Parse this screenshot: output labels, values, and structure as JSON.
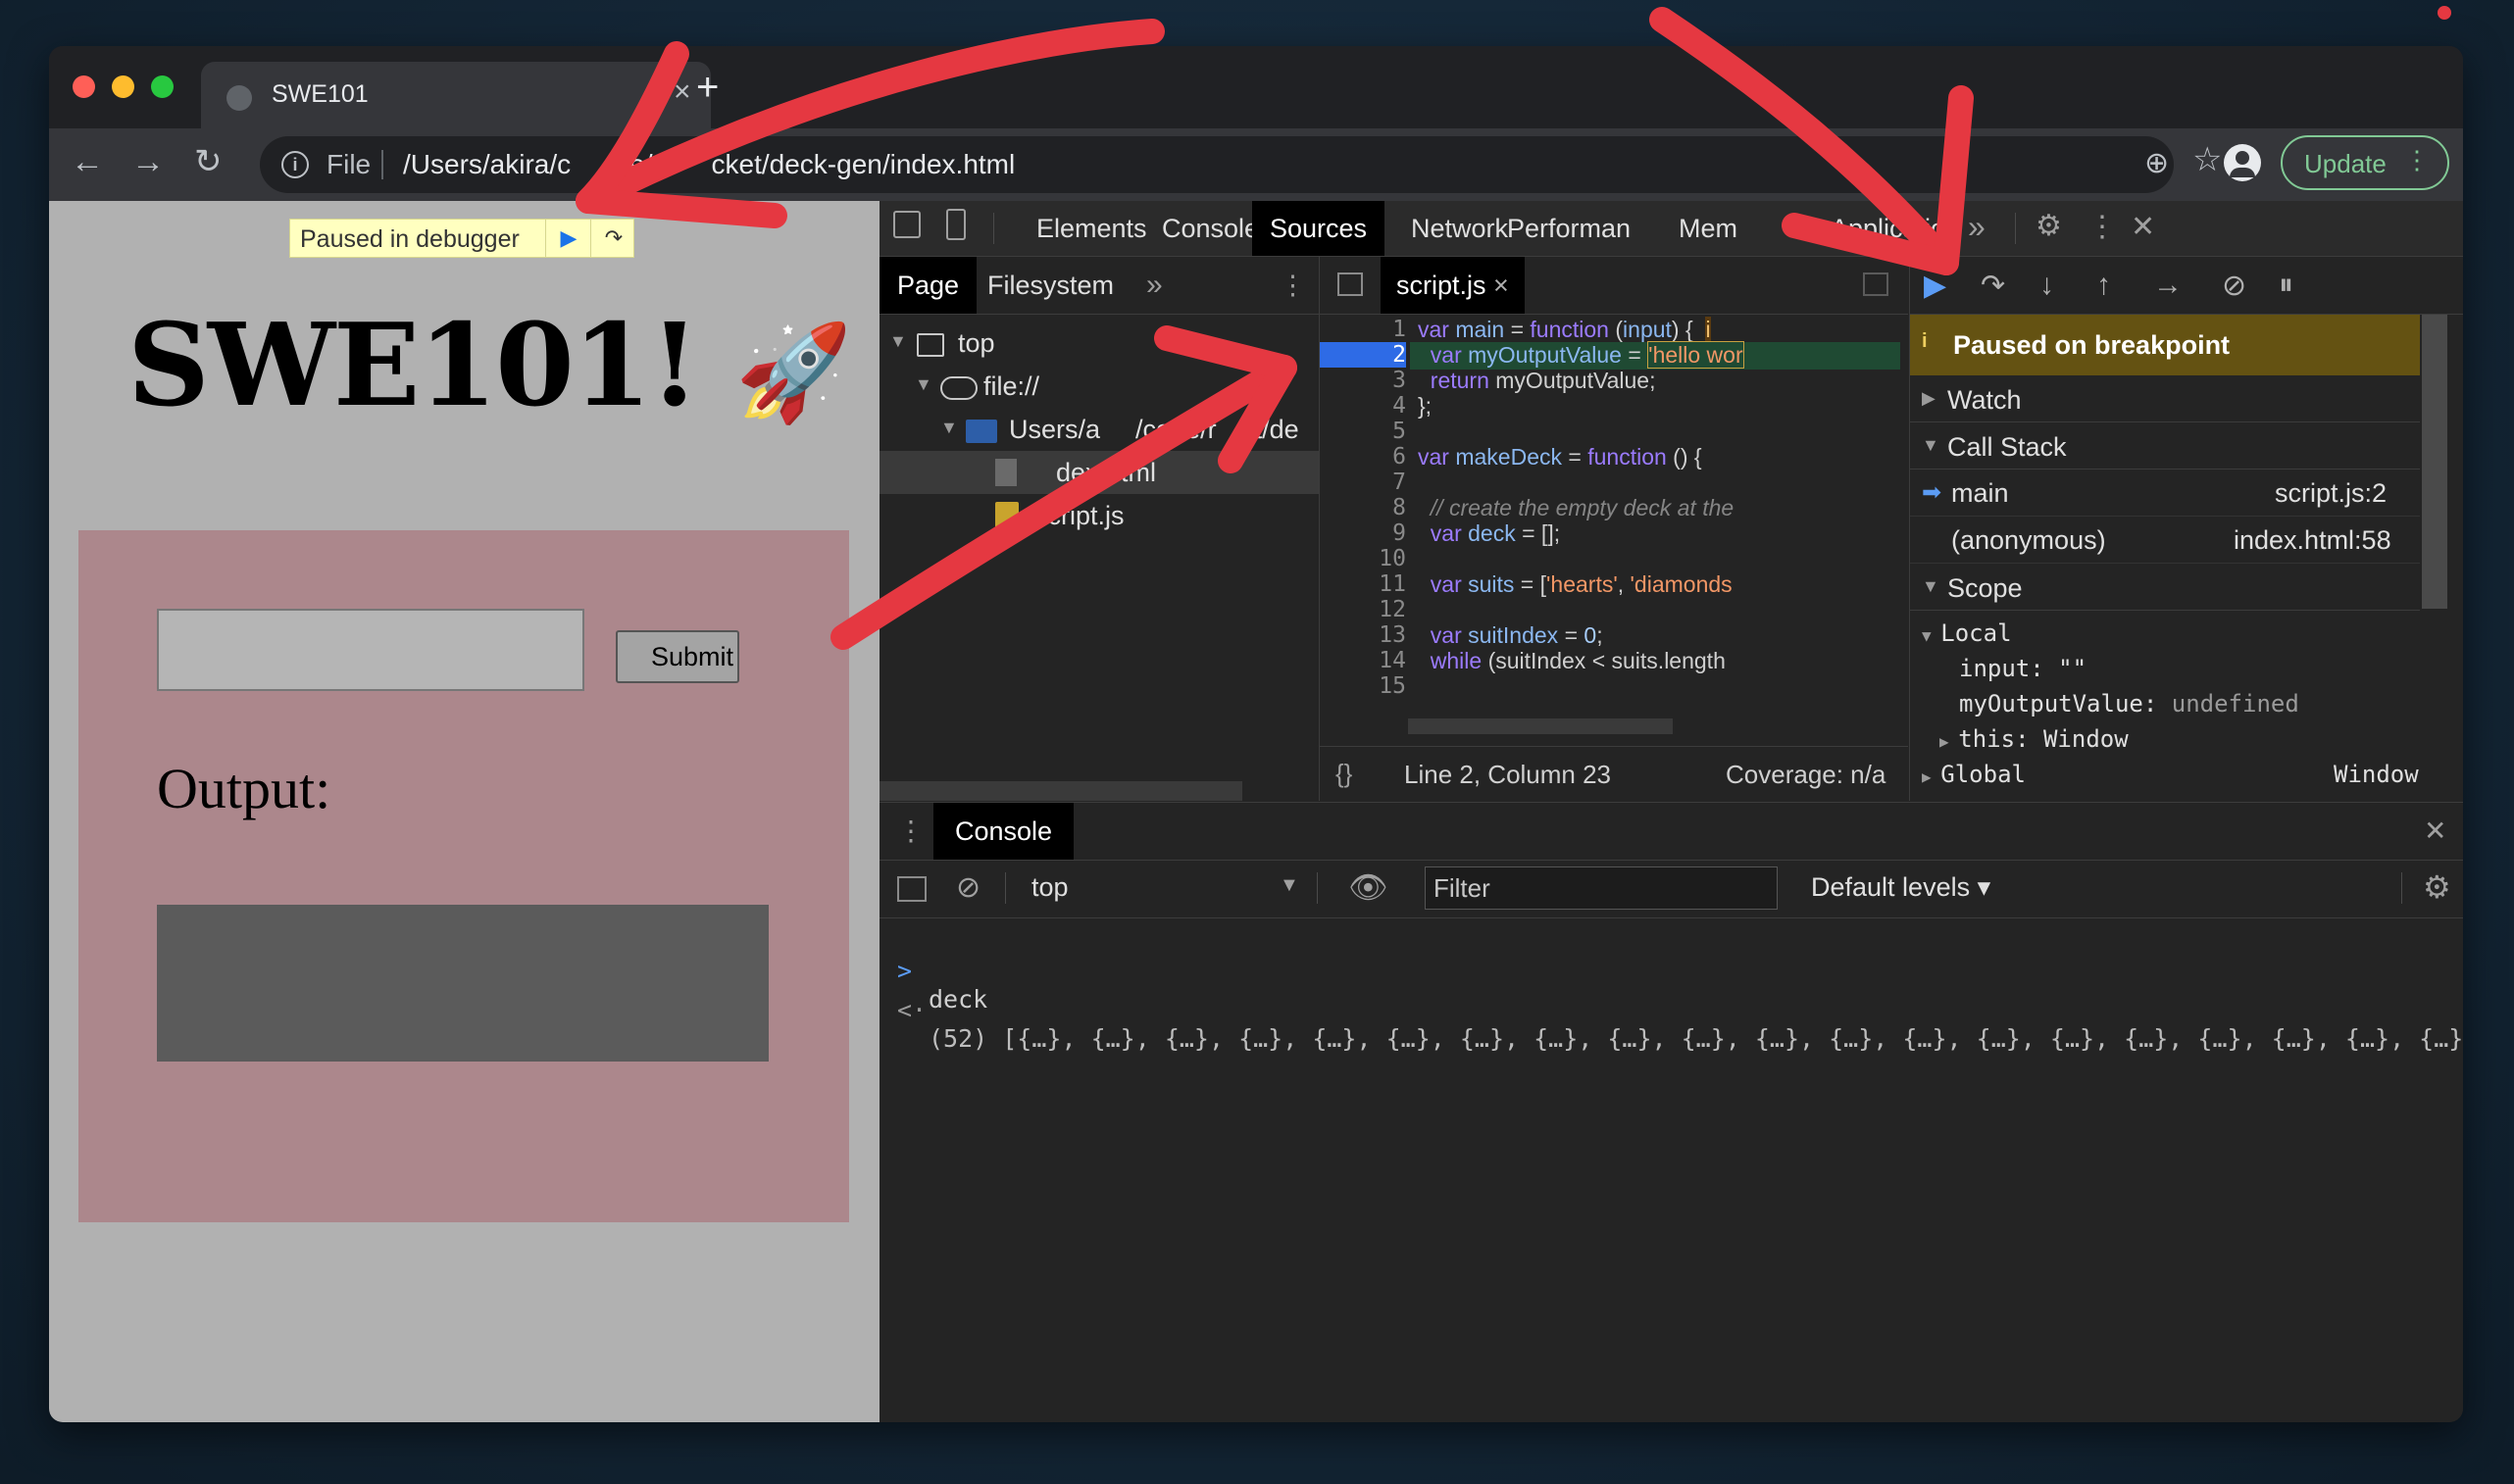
{
  "browser": {
    "tab_title": "SWE101",
    "tab_close": "×",
    "new_tab": "+",
    "back": "←",
    "forward": "→",
    "reload": "↻",
    "info_icon": "i",
    "url_scheme": "File",
    "url": "/Users/akira/code/rocket/deck-gen/index.html",
    "url_part_1": "/Users/akira/c",
    "url_part_2": "e/",
    "url_part_3": "cket/deck-gen/index.html",
    "update_label": "Update",
    "menu_glyph": "⋮",
    "zoom_glyph": "⊕",
    "star_glyph": "☆",
    "colors": {
      "close": "#ff5f57",
      "minimize": "#febc2e",
      "zoom": "#28c840",
      "update": "#81c995"
    }
  },
  "page": {
    "paused_label": "Paused in debugger",
    "resume_glyph": "▶",
    "step_glyph": "↷",
    "heading": "SWE101!",
    "rocket": "🚀",
    "input_value": "",
    "submit_label": "Submit",
    "output_label": "Output:"
  },
  "devtools": {
    "tabs": [
      "Elements",
      "Console",
      "Sources",
      "Network",
      "Performan",
      "Mem",
      "Application"
    ],
    "active_tab": "Sources",
    "more_tabs": "»",
    "settings_glyph": "⚙",
    "kebab_glyph": "⋮",
    "close_glyph": "✕",
    "navigator": {
      "tabs": [
        "Page",
        "Filesystem"
      ],
      "more": "»",
      "kebab": "⋮",
      "tree": [
        {
          "label": "top"
        },
        {
          "label": "file://"
        },
        {
          "label": "Users/a",
          "label_tail": "/code/r",
          "label_tail2": "et/de"
        },
        {
          "label": "dex.html"
        },
        {
          "label": "script.js"
        }
      ]
    },
    "editor": {
      "file_tab": "script.js",
      "file_close": "×",
      "line_numbers": [
        "1",
        "2",
        "3",
        "4",
        "5",
        "6",
        "7",
        "8",
        "9",
        "10",
        "11",
        "12",
        "13",
        "14",
        "15"
      ],
      "current_line": "2",
      "status_braces": "{}",
      "status_position": "Line 2, Column 23",
      "status_coverage": "Coverage: n/a"
    },
    "debugger": {
      "paused_icon": "i",
      "paused_text": "Paused on breakpoint",
      "watch_label": "Watch",
      "call_stack_label": "Call Stack",
      "call_stack": [
        {
          "fn": "main",
          "loc": "script.js:2"
        },
        {
          "fn": "(anonymous)",
          "loc": "index.html:58"
        }
      ],
      "scope_label": "Scope",
      "local_label": "Local",
      "scope_vars": [
        {
          "name": "input:",
          "value": "\"\""
        },
        {
          "name": "myOutputValue:",
          "value": "undefined"
        },
        {
          "name": "this:",
          "value": "Window"
        }
      ],
      "global_label": "Global",
      "global_value": "Window"
    },
    "drawer": {
      "tab": "Console",
      "close": "✕",
      "context": "top",
      "context_arrow": "▼",
      "filter_placeholder": "Filter",
      "levels": "Default levels ▾",
      "input_prompt": ">",
      "input_command": "deck",
      "output_prompt": "<·",
      "output_value": "(52) [{…}, {…}, {…}, {…}, {…}, {…}, {…}, {…}, {…}, {…}, {…}, {…}, {…}, {…}, {…}, {…}, {…}, {…}, {…}, {…}, {…"
    }
  },
  "annotation_color": "#e53841"
}
